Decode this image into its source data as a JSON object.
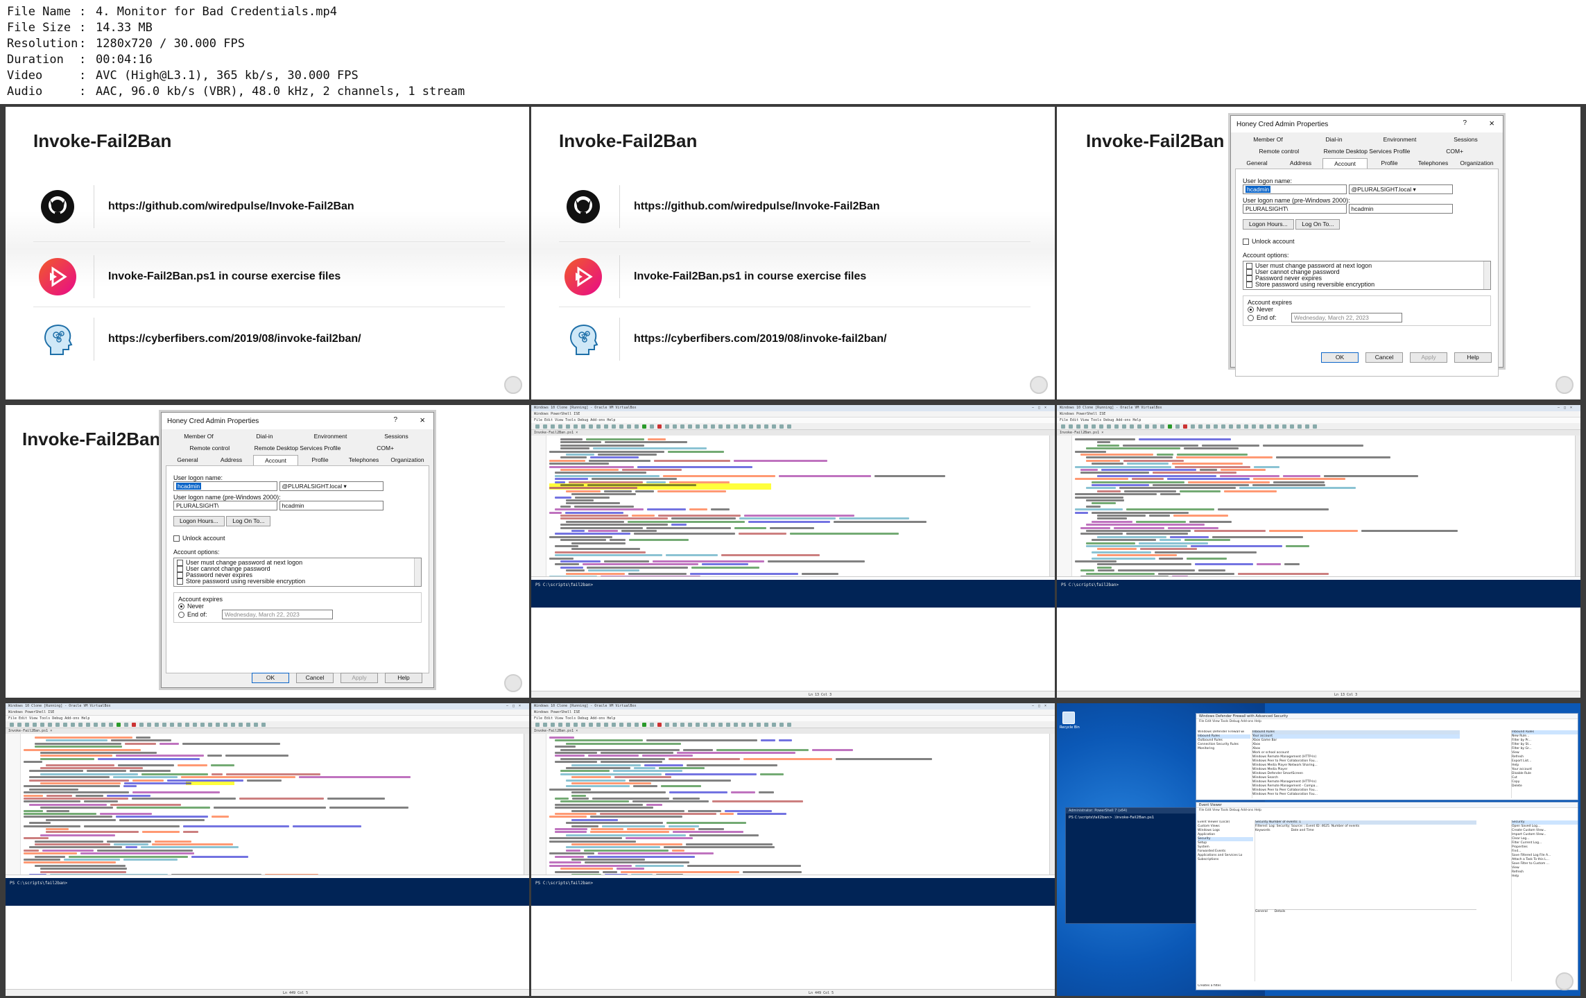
{
  "file_info": [
    {
      "key": "File Name",
      "value": "4. Monitor for Bad Credentials.mp4"
    },
    {
      "key": "File Size",
      "value": "14.33 MB"
    },
    {
      "key": "Resolution",
      "value": "1280x720 / 30.000 FPS"
    },
    {
      "key": "Duration",
      "value": "00:04:16"
    },
    {
      "key": "Video",
      "value": "AVC (High@L3.1), 365 kb/s, 30.000 FPS"
    },
    {
      "key": "Audio",
      "value": "AAC, 96.0 kb/s (VBR), 48.0 kHz, 2 channels, 1 stream"
    }
  ],
  "slide": {
    "title": "Invoke-Fail2Ban",
    "link_github_a": "https://github.com/wiredpulse/Invoke-Fail2Ban",
    "link_github_b": "https://github.com/wiredpulse/Invoke-Fail2Ban",
    "course_files": "Invoke-Fail2Ban.ps1 in course exercise files",
    "link_blog": "https://cyberfibers.com/2019/08/invoke-fail2ban/",
    "icons": [
      "github-icon",
      "pluralsight-icon",
      "brain-head-icon"
    ]
  },
  "dialog": {
    "title": "Honey Cred Admin Properties",
    "help_glyph": "?",
    "close_glyph": "×",
    "tabs_row1": [
      "Member Of",
      "Dial-in",
      "Environment",
      "Sessions"
    ],
    "tabs_row2": [
      "Remote control",
      "Remote Desktop Services Profile",
      "COM+"
    ],
    "tabs_row3": [
      "General",
      "Address",
      "Account",
      "Profile",
      "Telephones",
      "Organization"
    ],
    "active_tab": "Account",
    "logon_name_label": "User logon name:",
    "logon_name_value": "hcadmin",
    "domain_value": "@PLURALSIGHT.local",
    "pre2000_label": "User logon name (pre-Windows 2000):",
    "pre2000_domain": "PLURALSIGHT\\",
    "pre2000_value": "hcadmin",
    "logon_hours": "Logon Hours...",
    "log_on_to": "Log On To...",
    "unlock": "Unlock account",
    "options_label": "Account options:",
    "options": [
      "User must change password at next logon",
      "User cannot change password",
      "Password never expires",
      "Store password using reversible encryption"
    ],
    "expires_label": "Account expires",
    "never": "Never",
    "end_of": "End of:",
    "end_date": "Wednesday,   March   22, 2023",
    "ok": "OK",
    "cancel": "Cancel",
    "apply": "Apply",
    "help": "Help"
  },
  "ise": {
    "title": "Windows 10 Clone [Running] - Oracle VM VirtualBox",
    "app_title": "Windows PowerShell ISE",
    "menu": "File  Edit  View  Tools  Debug  Add-ons  Help",
    "file_tab": "Invoke-Fail2Ban.ps1 ×",
    "prompt": "PS C:\\scripts\\fail2ban>",
    "status_a": "Ln 13  Col 3",
    "status_b": "Ln 449  Col 5"
  },
  "desktop": {
    "recycle_bin": "Recycle Bin",
    "ps_title": "Administrator: PowerShell 7 (x64)",
    "ps_cmd": "PS C:\\scripts\\fail2ban> .\\Invoke-Fail2Ban.ps1",
    "firewall_title": "Windows Defender Firewall with Advanced Security",
    "firewall_nodes": [
      "Windows Defender Firewall wi",
      "Inbound Rules",
      "Outbound Rules",
      "Connection Security Rules",
      "Monitoring"
    ],
    "inbound_header": "Inbound Rules",
    "inbound_rules": [
      "Your account",
      "Xbox Game Bar",
      "Xbox",
      "Xbox",
      "Work or school account",
      "Windows Remote Management (HTTP-In)",
      "Windows Peer to Peer Collaboration Fou...",
      "Windows Media Player Network Sharing...",
      "Windows Media Player",
      "Windows Defender SmartScreen",
      "Windows Search",
      "Windows Remote Management (HTTP-In)",
      "Windows Remote Management - Compa...",
      "Windows Peer to Peer Collaboration Fou...",
      "Windows Peer to Peer Collaboration Fou..."
    ],
    "actions_header": "Actions",
    "actions": [
      "Inbound Rules",
      "New Rule...",
      "Filter by Pr...",
      "Filter by St...",
      "Filter by Gr...",
      "View",
      "Refresh",
      "Export List...",
      "Help",
      "Your account",
      "Disable Rule",
      "Cut",
      "Copy",
      "Delete"
    ],
    "eventviewer_title": "Event Viewer",
    "ev_tree": [
      "Event Viewer (Local)",
      "Custom Views",
      "Windows Logs",
      "Application",
      "Security",
      "Setup",
      "System",
      "Forwarded Events",
      "Applications and Services Lo",
      "Subscriptions"
    ],
    "ev_header": "Security   Number of events: 1",
    "ev_filter": "Filtered: Log: Security; Source: ; Event ID: 4625. Number of events",
    "ev_cols": [
      "Keywords",
      "Date and Time"
    ],
    "ev_tabs": [
      "General",
      "Details"
    ],
    "ev_actions": [
      "Security",
      "Open Saved Log...",
      "Create Custom View...",
      "Import Custom View...",
      "Clear Log...",
      "Filter Current Log...",
      "Properties",
      "Find...",
      "Save Filtered Log File A...",
      "Attach a Task To this L...",
      "Save Filter to Custom ...",
      "View",
      "Refresh",
      "Help"
    ],
    "ev_status": "Creates a filter."
  },
  "colors": {
    "grid_bg": "#3b3b3b",
    "console_bg": "#012456",
    "desktop_bg": "#0b58b6",
    "highlight": "#ffff3c",
    "selection": "#0a64c8"
  }
}
